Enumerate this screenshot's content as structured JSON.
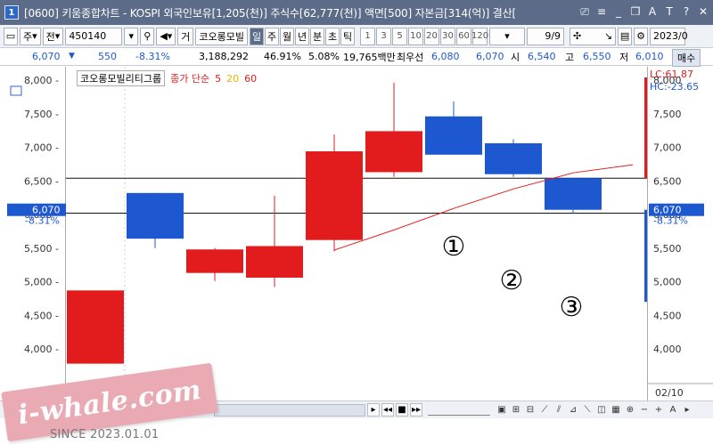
{
  "title_bar": {
    "app_icon": "1",
    "title": "[0600] 키움종합차트 - KOSPI 외국인보유[1,205(천)] 주식수[62,777(천)] 액면[500] 자본금[314(억)] 결산[",
    "icons": [
      "window-icon",
      "menu-icon",
      "minimize-icon",
      "restore-icon",
      "font-icon",
      "text-icon",
      "help-icon",
      "close-icon"
    ],
    "icon_glyphs": [
      "⎚",
      "≡",
      "_",
      "❐",
      "A",
      "T",
      "?",
      "✕"
    ]
  },
  "toolbar": {
    "type_label": "주",
    "period_label": "전",
    "code_value": "450140",
    "search_icon": "⚲",
    "view_label": "거",
    "stock_name": "코오롱모빌",
    "periods": [
      "일",
      "주",
      "월",
      "년",
      "분",
      "초",
      "틱"
    ],
    "selected_period": "일",
    "numbers": [
      "1",
      "3",
      "5",
      "10",
      "20",
      "30",
      "60",
      "120"
    ],
    "page": "9/9",
    "date": "2023/0"
  },
  "price_row": {
    "price": "6,070",
    "arrow": "▼",
    "change": "550",
    "change_pct": "-8.31%",
    "volume": "3,188,292",
    "vol_ratio": "46.91%",
    "turnover": "5.08%",
    "amount": "19,765백만",
    "best_label": "최우선",
    "best_ask": "6,080",
    "best_bid": "6,070",
    "open_label": "시",
    "open": "6,540",
    "high_label": "고",
    "high": "6,550",
    "low_label": "저",
    "low": "6,010",
    "trade_label": "매수"
  },
  "legend": {
    "name": "코오롱모빌리티그룹",
    "series_label": "종가 단순",
    "ma5": "5",
    "ma20": "20",
    "ma60": "60"
  },
  "right_info": {
    "lc": "LC:61.87",
    "hc": "HC:-23.65",
    "price_tag": "6,070",
    "pct_tag": "-8.31%"
  },
  "left_tag": {
    "price": "6,070",
    "pct": "-8.31%"
  },
  "markers": [
    "①",
    "②",
    "③"
  ],
  "x_label": "02/10",
  "brand": {
    "logo": "i-whale.com",
    "since": "SINCE 2023.01.01"
  },
  "colors": {
    "up": "#e21c1c",
    "down": "#1d58d1",
    "title_bg": "#5b6b88",
    "ma5_line": "#e21c1c",
    "ma20": "#e8b400",
    "ma60": "#e21c1c"
  },
  "chart_data": {
    "type": "candlestick",
    "y_ticks": [
      4000,
      4500,
      5000,
      5500,
      6000,
      6500,
      7000,
      7500,
      8000
    ],
    "y_tick_labels": [
      "4,000",
      "4,500",
      "5,000",
      "5,500",
      "6,000",
      "6,500",
      "7,000",
      "7,500",
      "8,000"
    ],
    "ylim": [
      3600,
      8100
    ],
    "candles": [
      {
        "open": 3780,
        "close": 4870,
        "high": 4870,
        "low": 3780
      },
      {
        "open": 6320,
        "close": 5640,
        "high": 6320,
        "low": 5500
      },
      {
        "open": 5130,
        "close": 5480,
        "high": 5500,
        "low": 5010
      },
      {
        "open": 5060,
        "close": 5530,
        "high": 6280,
        "low": 4920
      },
      {
        "open": 5620,
        "close": 6940,
        "high": 7190,
        "low": 5450
      },
      {
        "open": 6630,
        "close": 7240,
        "high": 7960,
        "low": 6560
      },
      {
        "open": 7460,
        "close": 6890,
        "high": 7680,
        "low": 6890
      },
      {
        "open": 7060,
        "close": 6600,
        "high": 7120,
        "low": 6560
      },
      {
        "open": 6540,
        "close": 6070,
        "high": 6550,
        "low": 6010
      }
    ],
    "ma5": [
      5470,
      5770,
      6090,
      6380,
      6620,
      6740
    ],
    "hlines": [
      6540,
      6020
    ]
  }
}
